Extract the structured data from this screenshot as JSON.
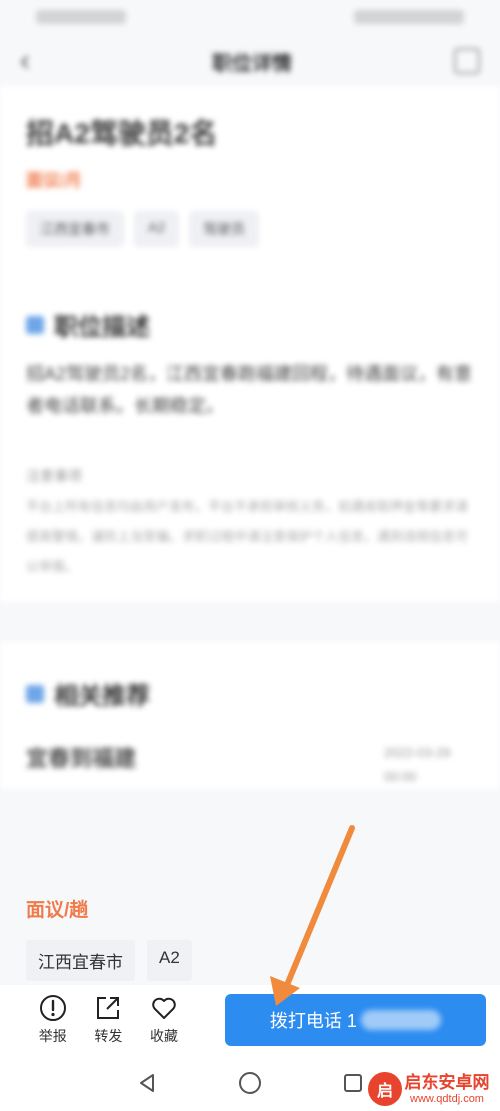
{
  "header": {
    "title": "职位详情"
  },
  "job": {
    "title": "招A2驾驶员2名",
    "salary": "面议/月",
    "tags": [
      "江西宜春市",
      "A2",
      "驾驶员"
    ]
  },
  "description": {
    "section_title": "职位描述",
    "text": "招A2驾驶员2名，江西宜春跑福建回程，待遇面议，有意者电话联系。长期稳定。",
    "notice_title": "注意事项",
    "notice_text": "平台上所有信息均由用户发布，平台不承担审核义务，如遇收取押金等要求请提高警惕，谨防上当受骗。求职过程中请注意保护个人信息，遇到违规信息可以举报。"
  },
  "recommend": {
    "section_title": "相关推荐",
    "item": {
      "title": "宜春到福建",
      "date": "2022-03-29 00:00",
      "salary": "面议/趟",
      "tags": [
        "江西宜春市",
        "A2"
      ]
    }
  },
  "actions": [
    {
      "label": "举报",
      "icon": "report-icon"
    },
    {
      "label": "转发",
      "icon": "forward-icon"
    },
    {
      "label": "收藏",
      "icon": "heart-icon"
    }
  ],
  "call_button": {
    "label": "拨打电话 1"
  },
  "watermark": {
    "name": "启东安卓网",
    "url": "www.qdtdj.com",
    "logo_char": "启"
  },
  "colors": {
    "primary": "#2d8cf0",
    "salary": "#f07a4a",
    "annotation_arrow": "#f08a3c"
  }
}
